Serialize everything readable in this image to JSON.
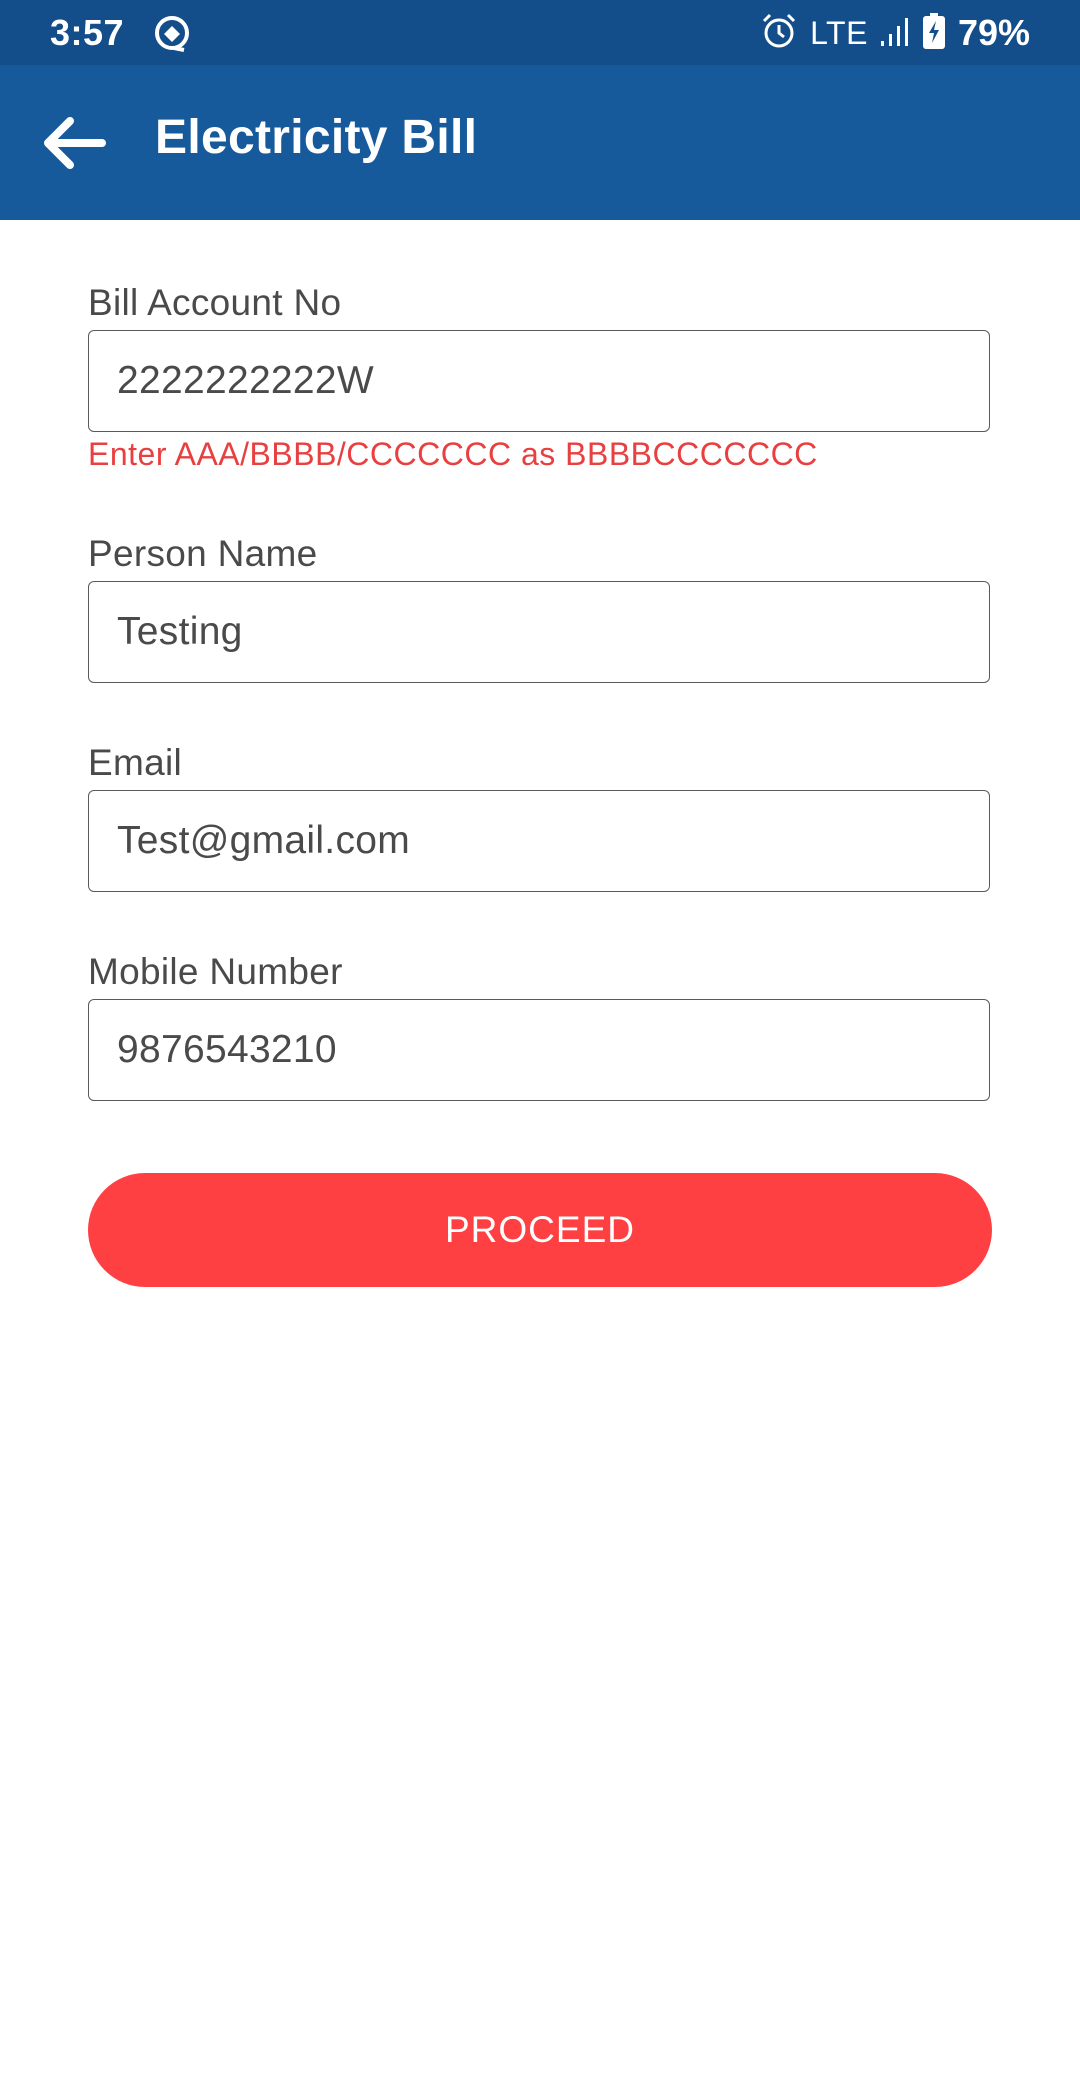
{
  "status_bar": {
    "time": "3:57",
    "app_notification_icon": "quick-settings-app-icon",
    "alarm_icon": "alarm-clock-icon",
    "network": "LTE",
    "signal_icon": "signal-bars-icon",
    "battery_icon": "battery-charging-icon",
    "battery_percent": "79%"
  },
  "app_bar": {
    "back_icon": "arrow-left-icon",
    "title": "Electricity Bill",
    "background_color": "#165a9c"
  },
  "form": {
    "fields": [
      {
        "label": "Bill Account No",
        "value": "2222222222W",
        "error": "Enter AAA/BBBB/CCCCCCC as BBBBCCCCCCC"
      },
      {
        "label": "Person Name",
        "value": "Testing"
      },
      {
        "label": "Email",
        "value": "Test@gmail.com"
      },
      {
        "label": "Mobile Number",
        "value": "9876543210"
      }
    ],
    "error_color": "#e84040"
  },
  "proceed_button": {
    "label": "PROCEED",
    "color": "#ff4043"
  }
}
